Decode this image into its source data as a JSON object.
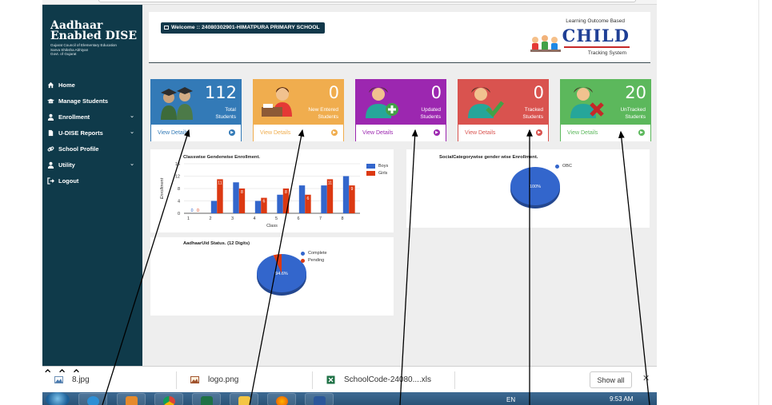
{
  "header": {
    "brand_line1": "Aadhaar",
    "brand_line2": "Enabled DISE",
    "brand_sub1": "Gujarat Council of Elementary Education",
    "brand_sub2": "Sarva Shiksha Abhiyan",
    "brand_sub3": "Govt. of Gujarat",
    "welcome": "Welcome :: 24080302901-HIMATPURA PRIMARY SCHOOL",
    "child_tagline": "Learning Outcome Based",
    "child_word": "CHILD",
    "child_tracking": "Tracking System"
  },
  "nav": {
    "items": [
      {
        "label": "Home",
        "icon": "home-icon",
        "has_caret": false
      },
      {
        "label": "Manage Students",
        "icon": "graduation-cap-icon",
        "has_caret": false
      },
      {
        "label": "Enrollment",
        "icon": "user-icon",
        "has_caret": true
      },
      {
        "label": "U-DISE Reports",
        "icon": "file-icon",
        "has_caret": true
      },
      {
        "label": "School Profile",
        "icon": "link-icon",
        "has_caret": false
      },
      {
        "label": "Utility",
        "icon": "user-icon",
        "has_caret": true
      },
      {
        "label": "Logout",
        "icon": "sign-out-icon",
        "has_caret": false
      }
    ]
  },
  "tiles": [
    {
      "value": "112",
      "label1": "Total",
      "label2": "Students",
      "color": "#337ab7",
      "footer": "View Details"
    },
    {
      "value": "0",
      "label1": "New Entered",
      "label2": "Students",
      "color": "#f0ad4e",
      "footer": "View Details"
    },
    {
      "value": "0",
      "label1": "Updated",
      "label2": "Students",
      "color": "#9c27b0",
      "footer": "View Details"
    },
    {
      "value": "0",
      "label1": "Tracked",
      "label2": "Students",
      "color": "#d9534f",
      "footer": "View Details"
    },
    {
      "value": "20",
      "label1": "UnTracked",
      "label2": "Students",
      "color": "#5cb85c",
      "footer": "View Details"
    }
  ],
  "chart_data": [
    {
      "type": "bar",
      "title": "Classwise Genderwise Enrollment.",
      "xlabel": "Class",
      "ylabel": "Enrollment",
      "categories": [
        "1",
        "2",
        "3",
        "4",
        "5",
        "6",
        "7",
        "8"
      ],
      "series": [
        {
          "name": "Boys",
          "values": [
            0,
            4,
            10,
            4,
            6,
            9,
            9,
            12
          ],
          "color": "#3366cc"
        },
        {
          "name": "Girls",
          "values": [
            0,
            11,
            8,
            5,
            8,
            6,
            11,
            9
          ],
          "color": "#dc3912"
        }
      ],
      "data_labels": {
        "Girls": [
          "0",
          "11",
          "8",
          "6",
          "8",
          "6",
          "11",
          "9"
        ],
        "Boys": [
          "0",
          "",
          "",
          "",
          "",
          "",
          "",
          ""
        ]
      },
      "yticks": [
        0,
        4,
        8,
        12,
        16
      ],
      "ylim": [
        0,
        16
      ],
      "legend": "top-right"
    },
    {
      "type": "pie",
      "title": "SocialCategorywise gender wise Enrollment.",
      "slices": [
        {
          "label": "OBC",
          "value": 100,
          "color": "#3366cc"
        }
      ],
      "slice_labels": [
        "100%"
      ],
      "legend": "top-right"
    },
    {
      "type": "pie",
      "title": "AadhaarUid Status. (12 Digits)",
      "slices": [
        {
          "label": "Complete",
          "value": 94.6,
          "color": "#3366cc"
        },
        {
          "label": "Pending",
          "value": 5.4,
          "color": "#dc3912"
        }
      ],
      "slice_labels": [
        "94.6%"
      ],
      "legend": "right"
    }
  ],
  "downloads": {
    "items": [
      {
        "name": "8.jpg",
        "icon": "image-file-icon"
      },
      {
        "name": "logo.png",
        "icon": "image-file-icon"
      },
      {
        "name": "SchoolCode-24080....xls",
        "icon": "excel-file-icon"
      }
    ],
    "show_all": "Show all"
  },
  "taskbar": {
    "lang": "EN",
    "time": "9:53 AM"
  }
}
